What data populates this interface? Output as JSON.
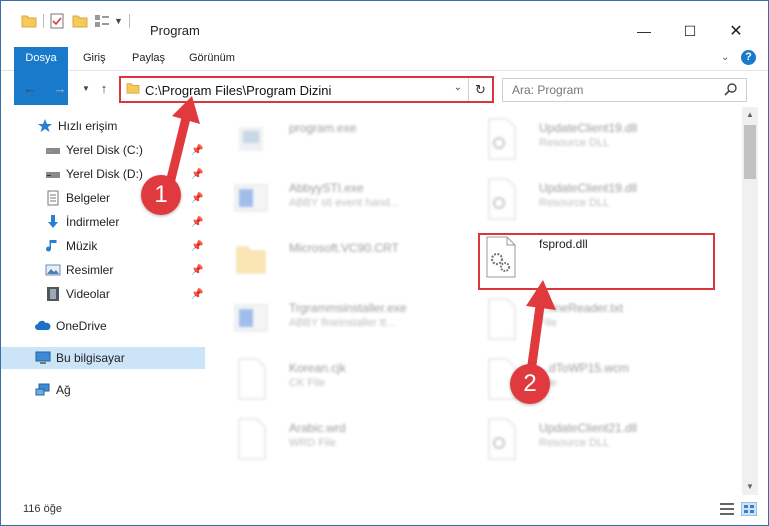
{
  "window": {
    "title": "Program"
  },
  "ribbon": {
    "tabs": [
      "Dosya",
      "Giriş",
      "Paylaş",
      "Görünüm"
    ]
  },
  "address": {
    "path": "C:\\Program Files\\Program Dizini"
  },
  "search": {
    "placeholder": "Ara: Program"
  },
  "sidebar": {
    "items": [
      {
        "label": "Hızlı erişim",
        "icon": "star-icon",
        "pinned": false
      },
      {
        "label": "Yerel Disk (C:)",
        "icon": "drive-icon",
        "pinned": true
      },
      {
        "label": "Yerel Disk (D:)",
        "icon": "drive-icon",
        "pinned": true
      },
      {
        "label": "Belgeler",
        "icon": "documents-icon",
        "pinned": true
      },
      {
        "label": "İndirmeler",
        "icon": "download-icon",
        "pinned": true
      },
      {
        "label": "Müzik",
        "icon": "music-icon",
        "pinned": true
      },
      {
        "label": "Resimler",
        "icon": "pictures-icon",
        "pinned": true
      },
      {
        "label": "Videolar",
        "icon": "video-icon",
        "pinned": true
      },
      {
        "label": "OneDrive",
        "icon": "cloud-icon",
        "pinned": false
      },
      {
        "label": "Bu bilgisayar",
        "icon": "computer-icon",
        "pinned": false,
        "selected": true
      },
      {
        "label": "Ağ",
        "icon": "network-icon",
        "pinned": false
      }
    ]
  },
  "files": {
    "left": [
      {
        "name": "program.exe",
        "sub": "",
        "icon": "exe-icon"
      },
      {
        "name": "AbbyySTI.exe",
        "sub": "ABBY sti event hand...",
        "icon": "exe-icon"
      },
      {
        "name": "Microsoft.VC90.CRT",
        "sub": "",
        "icon": "folder-icon"
      },
      {
        "name": "Trgrammsinstaller.exe",
        "sub": "ABBY fineinstaller tt...",
        "icon": "exe-icon"
      },
      {
        "name": "Korean.cjk",
        "sub": "CK File",
        "icon": "file-icon"
      },
      {
        "name": "Arabic.wrd",
        "sub": "WRD File",
        "icon": "file-icon"
      }
    ],
    "right": [
      {
        "name": "UpdateClient19.dll",
        "sub": "Resource DLL",
        "icon": "dll-icon"
      },
      {
        "name": "UpdateClient19.dll",
        "sub": "Resource DLL",
        "icon": "dll-icon"
      },
      {
        "name": "fsprod.dll",
        "sub": "",
        "icon": "dll-icon",
        "highlighted": true
      },
      {
        "name": "...fineReader.txt",
        "sub": "File",
        "icon": "file-icon"
      },
      {
        "name": "...dToWP15.wcm",
        "sub": "File",
        "icon": "file-icon"
      },
      {
        "name": "UpdateClient21.dll",
        "sub": "Resource DLL",
        "icon": "dll-icon"
      }
    ]
  },
  "status": {
    "count": "116 öğe"
  },
  "annotations": {
    "step1": "1",
    "step2": "2"
  },
  "colors": {
    "accent": "#1979ca",
    "highlight": "#d9363e",
    "selected": "#cce4f7"
  }
}
